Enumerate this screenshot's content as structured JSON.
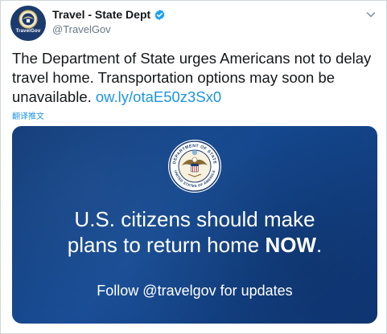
{
  "account": {
    "display_name": "Travel - State Dept",
    "handle": "@TravelGov",
    "avatar_label": "TravelGov",
    "verified_icon": "verified-badge-icon"
  },
  "tweet": {
    "text_before_link": "The Department of State urges Americans not to delay travel home. Transportation options may soon be unavailable. ",
    "link_text": "ow.ly/otaE50z3Sx0",
    "translate_label": "翻译推文"
  },
  "media": {
    "headline_line1": "U.S. citizens should make",
    "headline_line2_prefix": "plans to return home ",
    "headline_line2_emphasis": "NOW",
    "headline_line2_suffix": ".",
    "follow_text": "Follow @travelgov for updates",
    "seal_icon": "department-of-state-seal-icon",
    "seal_text_top": "DEPARTMENT OF STATE",
    "seal_text_bottom": "UNITED STATES OF AMERICA"
  },
  "colors": {
    "link": "#1b95e0",
    "verified": "#1da1f2",
    "media_bg": "#154a93",
    "text": "#14171a",
    "secondary": "#657786"
  }
}
